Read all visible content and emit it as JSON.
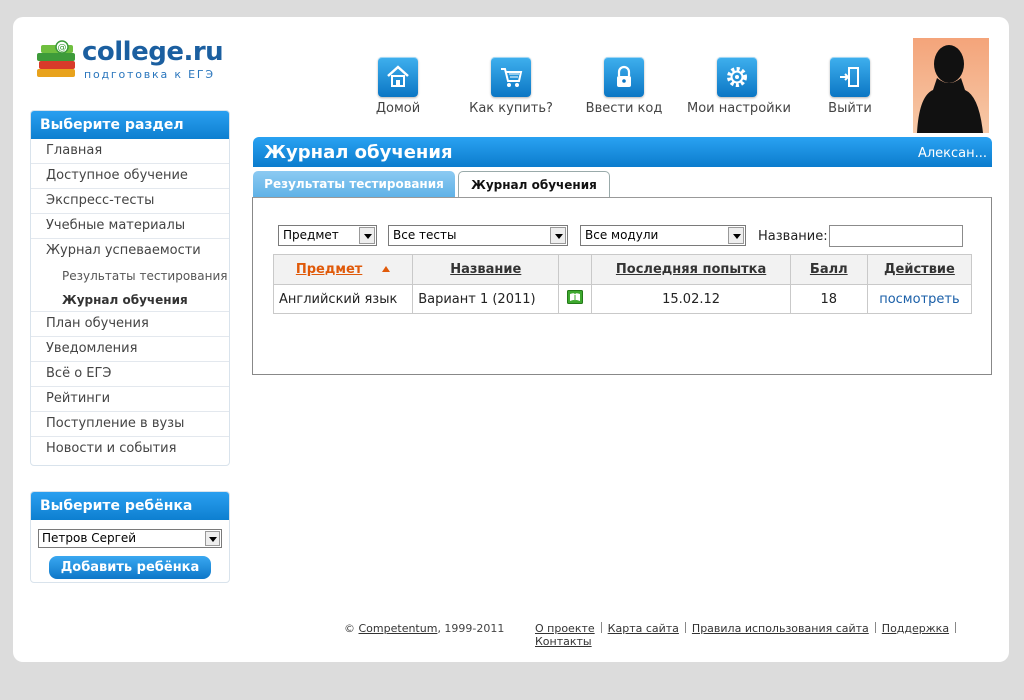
{
  "logo": {
    "brand": "college.ru",
    "tagline": "подготовка к ЕГЭ"
  },
  "topnav": [
    {
      "label": "Домой",
      "icon": "home-icon"
    },
    {
      "label": "Как купить?",
      "icon": "cart-icon"
    },
    {
      "label": "Ввести код",
      "icon": "lock-icon"
    },
    {
      "label": "Мои настройки",
      "icon": "gear-icon"
    },
    {
      "label": "Выйти",
      "icon": "exit-door-icon"
    }
  ],
  "sidebar": {
    "section_title": "Выберите раздел",
    "items": [
      "Главная",
      "Доступное обучение",
      "Экспресс-тесты",
      "Учебные материалы",
      "Журнал успеваемости"
    ],
    "subitems": [
      "Результаты тестирования",
      "Журнал обучения"
    ],
    "items_after": [
      "План обучения",
      "Уведомления",
      "Всё о ЕГЭ",
      "Рейтинги",
      "Поступление в вузы",
      "Новости и события"
    ],
    "child_title": "Выберите ребёнка",
    "child_selected": "Петров Сергей",
    "add_child_label": "Добавить ребёнка"
  },
  "main": {
    "title": "Журнал обучения",
    "user": "Алексан...",
    "tabs": [
      "Результаты тестирования",
      "Журнал обучения"
    ],
    "filters": {
      "subject": "Предмет",
      "tests": "Все тесты",
      "modules": "Все модули",
      "name_label": "Название:"
    },
    "table": {
      "headers": [
        "Предмет",
        "Название",
        "",
        "Последняя попытка",
        "Балл",
        "Действие"
      ],
      "rows": [
        {
          "subject": "Английский язык",
          "name": "Вариант 1 (2011)",
          "date": "15.02.12",
          "score": "18",
          "action": "посмотреть"
        }
      ]
    }
  },
  "footer": {
    "copyright_prefix": "©",
    "company": "Competentum",
    "years": ", 1999-2011",
    "links": [
      "О проекте",
      "Карта сайта",
      "Правила использования сайта",
      "Поддержка",
      "Контакты"
    ]
  },
  "colors": {
    "accent": "#0d7fd0",
    "sort": "#e05a0a",
    "score": "#cc0000"
  }
}
